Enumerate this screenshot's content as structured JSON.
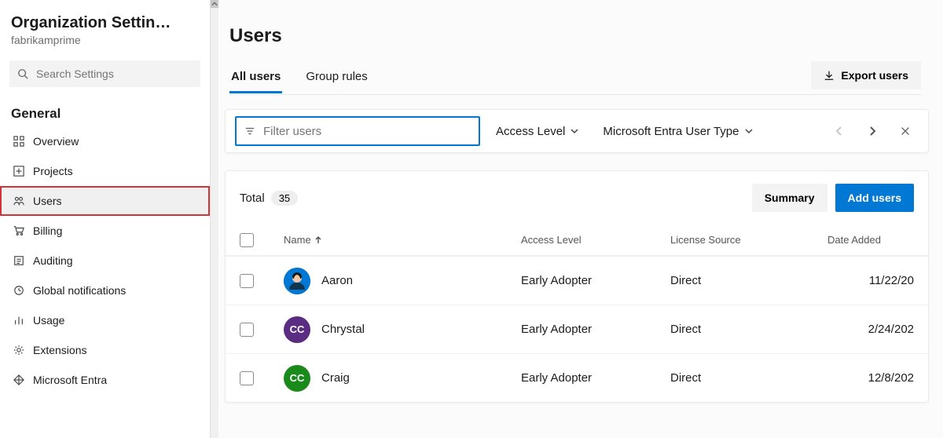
{
  "sidebar": {
    "title": "Organization Settin…",
    "subtitle": "fabrikamprime",
    "search_placeholder": "Search Settings",
    "section_general": "General",
    "items": [
      {
        "label": "Overview"
      },
      {
        "label": "Projects"
      },
      {
        "label": "Users"
      },
      {
        "label": "Billing"
      },
      {
        "label": "Auditing"
      },
      {
        "label": "Global notifications"
      },
      {
        "label": "Usage"
      },
      {
        "label": "Extensions"
      },
      {
        "label": "Microsoft Entra"
      }
    ]
  },
  "page": {
    "title": "Users",
    "export_label": "Export users",
    "tab_all_users": "All users",
    "tab_group_rules": "Group rules"
  },
  "filter": {
    "placeholder": "Filter users",
    "access_level_label": "Access Level",
    "entra_type_label": "Microsoft Entra User Type"
  },
  "table": {
    "total_label": "Total",
    "total_count": "35",
    "summary_label": "Summary",
    "add_label": "Add users",
    "col_name": "Name",
    "col_access": "Access Level",
    "col_license": "License Source",
    "col_date": "Date Added",
    "rows": [
      {
        "name": "Aaron",
        "initials": "",
        "avatar_bg": "#0078d4",
        "avatar_img": true,
        "access": "Early Adopter",
        "license": "Direct",
        "date": "11/22/20"
      },
      {
        "name": "Chrystal",
        "initials": "CC",
        "avatar_bg": "#5a2d82",
        "avatar_img": false,
        "access": "Early Adopter",
        "license": "Direct",
        "date": "2/24/202"
      },
      {
        "name": "Craig",
        "initials": "CC",
        "avatar_bg": "#1a8a1a",
        "avatar_img": false,
        "access": "Early Adopter",
        "license": "Direct",
        "date": "12/8/202"
      }
    ]
  }
}
